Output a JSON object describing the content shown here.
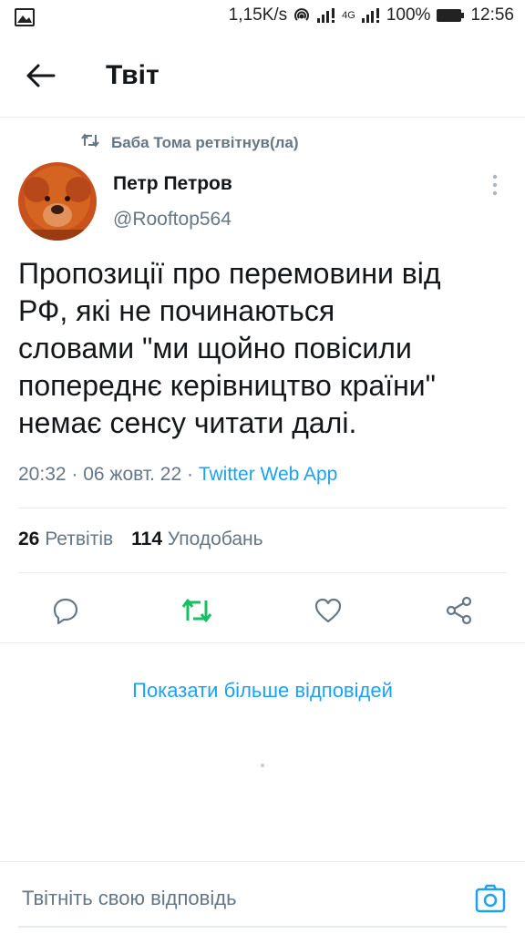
{
  "status_bar": {
    "network_speed": "1,15K/s",
    "network_type": "4G",
    "battery": "100%",
    "time": "12:56",
    "icons": [
      "gallery-icon",
      "hotspot-icon",
      "signal-icon",
      "battery-icon"
    ]
  },
  "header": {
    "title": "Твіт",
    "back_icon": "arrow-left-icon"
  },
  "tweet": {
    "retweeted_by": "Баба Тома ретвітнув(ла)",
    "author_name": "Петр Петров",
    "author_handle": "@Rooftop564",
    "text": "Пропозиції про перемовини від\nРФ, які не починаються\nсловами \"ми щойно повісили\nпопереднє керівництво країни\"\nнемає сенсу читати далі.",
    "time": "20:32",
    "date": "06 жовт. 22",
    "source": "Twitter Web App",
    "retweets_count": "26",
    "retweets_label": "Ретвітів",
    "likes_count": "114",
    "likes_label": "Уподобань"
  },
  "actions": {
    "icons": [
      "reply-icon",
      "retweet-icon",
      "like-icon",
      "share-icon"
    ],
    "retweet_active_color": "#17bf63"
  },
  "show_more": "Показати більше відповідей",
  "reply": {
    "placeholder": "Твітніть свою відповідь",
    "camera_icon": "camera-icon"
  },
  "colors": {
    "accent": "#1da1f2",
    "secondary_text": "#657786",
    "retweet_green": "#17bf63"
  }
}
